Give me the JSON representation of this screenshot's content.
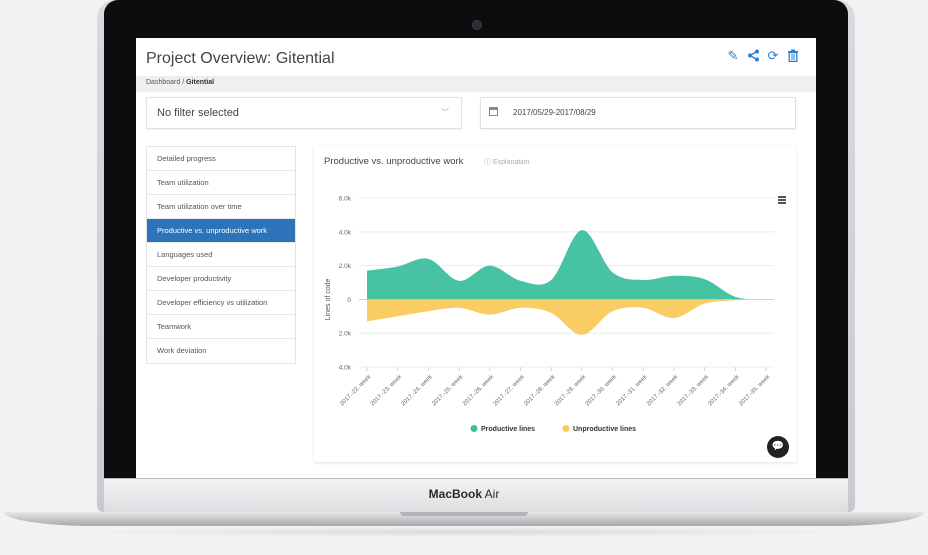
{
  "device": {
    "brand_bold": "MacBook",
    "brand_rest": " Air"
  },
  "app": {
    "title": "Project Overview: Gitential",
    "breadcrumb": {
      "root": "Dashboard",
      "separator": " / ",
      "current": "Gitential"
    },
    "filter": {
      "value": "No filter selected"
    },
    "date_range": {
      "value": "2017/05/29-2017/08/29"
    },
    "header_icons": [
      "pencil-icon",
      "share-icon",
      "refresh-icon",
      "trash-icon"
    ],
    "accent": "#2c73b9"
  },
  "nav": {
    "items": [
      {
        "label": "Detailed progress"
      },
      {
        "label": "Team utilization"
      },
      {
        "label": "Team utilization over time"
      },
      {
        "label": "Productive vs. unproductive work",
        "active": true
      },
      {
        "label": "Languages used"
      },
      {
        "label": "Developer productivity"
      },
      {
        "label": "Developer efficiency vs utilization"
      },
      {
        "label": "Teamwork"
      },
      {
        "label": "Work deviation"
      }
    ]
  },
  "chart_card": {
    "title": "Productive vs. unproductive work",
    "explanation": "Explanation"
  },
  "chart_data": {
    "type": "area",
    "title": "Productive vs. unproductive work",
    "ylabel": "Lines of code",
    "xlabel": "",
    "ylim": [
      -4000,
      6000
    ],
    "yticks": [
      "6.0k",
      "4.0k",
      "2.0k",
      "0",
      "2.0k",
      "4.0k"
    ],
    "categories": [
      "2017.-22. week",
      "2017.-23. week",
      "2017.-24. week",
      "2017.-25. week",
      "2017.-26. week",
      "2017.-27. week",
      "2017.-28. week",
      "2017.-29. week",
      "2017.-30. week",
      "2017.-31. week",
      "2017.-32. week",
      "2017.-33. week",
      "2017.-34. week",
      "2017.-35. week"
    ],
    "series": [
      {
        "name": "Productive lines",
        "color": "#3dbf9e",
        "values": [
          1700,
          1950,
          2400,
          1100,
          2000,
          1100,
          1150,
          4100,
          1600,
          1150,
          1400,
          1200,
          150,
          0
        ]
      },
      {
        "name": "Unproductive lines",
        "color": "#f9c95c",
        "values": [
          -1300,
          -1000,
          -700,
          -500,
          -900,
          -500,
          -800,
          -2100,
          -700,
          -500,
          -1100,
          -250,
          -50,
          0
        ]
      }
    ],
    "legend": "bottom-center",
    "grid": true
  }
}
